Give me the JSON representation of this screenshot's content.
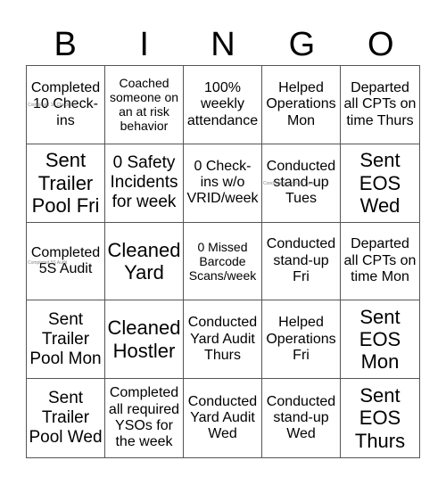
{
  "header": {
    "letters": [
      "B",
      "I",
      "N",
      "G",
      "O"
    ]
  },
  "board": {
    "rows": [
      [
        {
          "text": "Completed 10 Check-ins",
          "ghost": "Completed 10 Check-ins"
        },
        {
          "text": "Coached someone on an at risk behavior"
        },
        {
          "text": "100% weekly attendance"
        },
        {
          "text": "Helped Operations Mon"
        },
        {
          "text": "Departed all CPTs on time Thurs"
        }
      ],
      [
        {
          "text": "Sent Trailer Pool Fri"
        },
        {
          "text": "0 Safety Incidents for week"
        },
        {
          "text": "0 Check-ins w/o VRID/week"
        },
        {
          "text": "Conducted stand-up Tues",
          "ghost": "Conducted stand-up Tues"
        },
        {
          "text": "Sent EOS Wed"
        }
      ],
      [
        {
          "text": "Completed 5S Audit",
          "ghost": "Completed 5S Audit"
        },
        {
          "text": "Cleaned Yard"
        },
        {
          "text": "0 Missed Barcode Scans/week"
        },
        {
          "text": "Conducted stand-up Fri"
        },
        {
          "text": "Departed all CPTs on time Mon"
        }
      ],
      [
        {
          "text": "Sent Trailer Pool Mon"
        },
        {
          "text": "Cleaned Hostler"
        },
        {
          "text": "Conducted Yard Audit Thurs"
        },
        {
          "text": "Helped Operations Fri"
        },
        {
          "text": "Sent EOS Mon"
        }
      ],
      [
        {
          "text": "Sent Trailer Pool Wed"
        },
        {
          "text": "Completed all required YSOs for the week"
        },
        {
          "text": "Conducted Yard Audit Wed"
        },
        {
          "text": "Conducted stand-up Wed"
        },
        {
          "text": "Sent EOS Thurs"
        }
      ]
    ]
  }
}
